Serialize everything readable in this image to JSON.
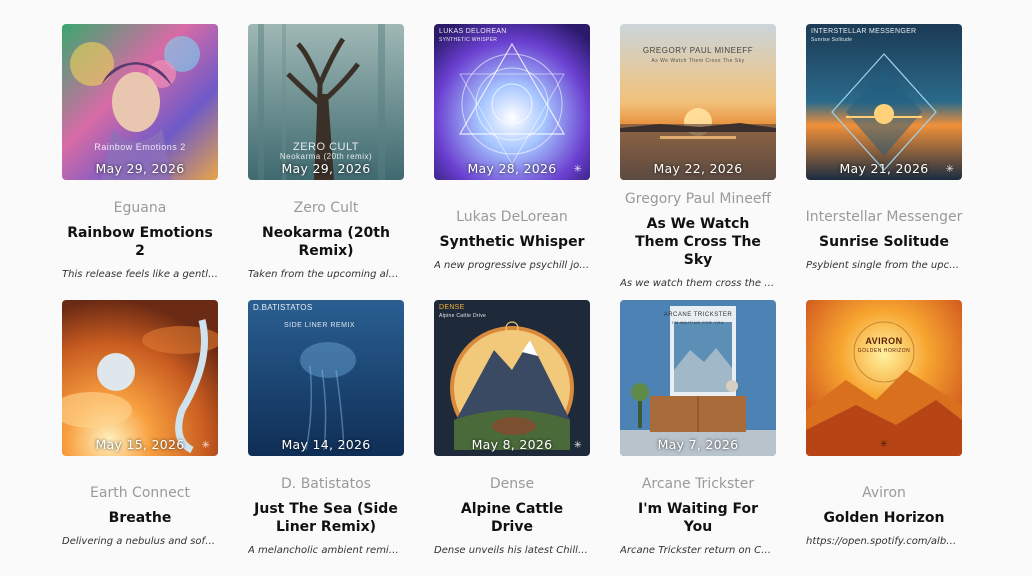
{
  "releases": [
    {
      "date": "May 29, 2026",
      "artist": "Eguana",
      "title": "Rainbow Emotions 2",
      "desc": "This release feels like a gentle sonic journey...",
      "overlay": "Rainbow Emotions 2",
      "overlay_sub": ""
    },
    {
      "date": "May 29, 2026",
      "artist": "Zero Cult",
      "title": "Neokarma (20th Remix)",
      "desc": "Taken from the upcoming album...",
      "overlay": "ZERO CULT",
      "overlay_sub": "Neokarma (20th remix)"
    },
    {
      "date": "May 28, 2026",
      "artist": "Lukas DeLorean",
      "title": "Synthetic Whisper",
      "desc": "A new progressive psychill journey...",
      "overlay": "LUKAS DELOREAN",
      "overlay_sub": "SYNTHETIC WHISPER"
    },
    {
      "date": "May 22, 2026",
      "artist": "Gregory Paul Mineeff",
      "title": "As We Watch Them Cross The Sky",
      "desc": "As we watch them cross the sky...",
      "overlay": "GREGORY PAUL MINEEFF",
      "overlay_sub": "As We Watch Them Cross The Sky"
    },
    {
      "date": "May 21, 2026",
      "artist": "Interstellar Messenger",
      "title": "Sunrise Solitude",
      "desc": "Psybient single from the upcoming album...",
      "overlay": "INTERSTELLAR MESSENGER",
      "overlay_sub": "Sunrise Solitude"
    },
    {
      "date": "May 15, 2026",
      "artist": "Earth Connect",
      "title": "Breathe",
      "desc": "Delivering a nebulus and soft ambient...",
      "overlay": "",
      "overlay_sub": ""
    },
    {
      "date": "May 14, 2026",
      "artist": "D. Batistatos",
      "title": "Just The Sea (Side Liner Remix)",
      "desc": "A melancholic ambient remix...",
      "overlay": "D.BATISTATOS",
      "overlay_sub": "SIDE LINER REMIX"
    },
    {
      "date": "May 8, 2026",
      "artist": "Dense",
      "title": "Alpine Cattle Drive",
      "desc": "Dense unveils his latest Chillout...",
      "overlay": "DENSE",
      "overlay_sub": "Alpine Cattle Drive"
    },
    {
      "date": "May 7, 2026",
      "artist": "Arcane Trickster",
      "title": "I'm Waiting For You",
      "desc": "Arcane Trickster return on Chill...",
      "overlay": "ARCANE TRICKSTER",
      "overlay_sub": "I'M WAITING FOR YOU"
    },
    {
      "date": "",
      "artist": "Aviron",
      "title": "Golden Horizon",
      "desc": "https://open.spotify.com/album...",
      "overlay": "AVIRON",
      "overlay_sub": "GOLDEN HORIZON"
    }
  ],
  "icons": {
    "badge": "sparkle-icon"
  },
  "colors": {
    "background": "#fafafa",
    "artist": "#9a9a9a",
    "title": "#111111"
  }
}
